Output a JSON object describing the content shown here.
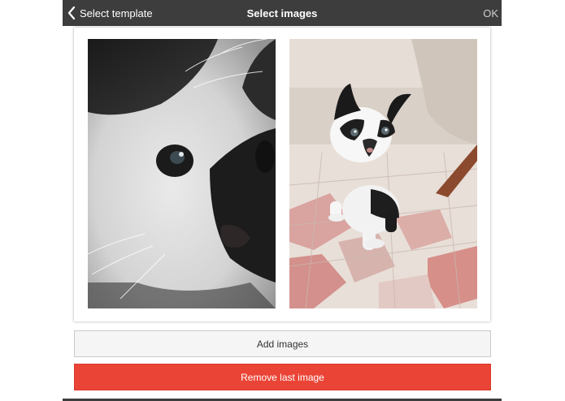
{
  "navbar": {
    "back_label": "Select template",
    "back_icon": "chevron-left-icon",
    "title": "Select images",
    "ok_label": "OK"
  },
  "images": [
    {
      "subject": "close-up of white and black kitten face"
    },
    {
      "subject": "black and white kitten walking on tiled floor"
    }
  ],
  "buttons": {
    "add_label": "Add images",
    "remove_label": "Remove last image"
  },
  "colors": {
    "navbar_bg": "#3d3d3d",
    "remove_button": "#ea4436",
    "add_button_bg": "#f5f5f5"
  }
}
